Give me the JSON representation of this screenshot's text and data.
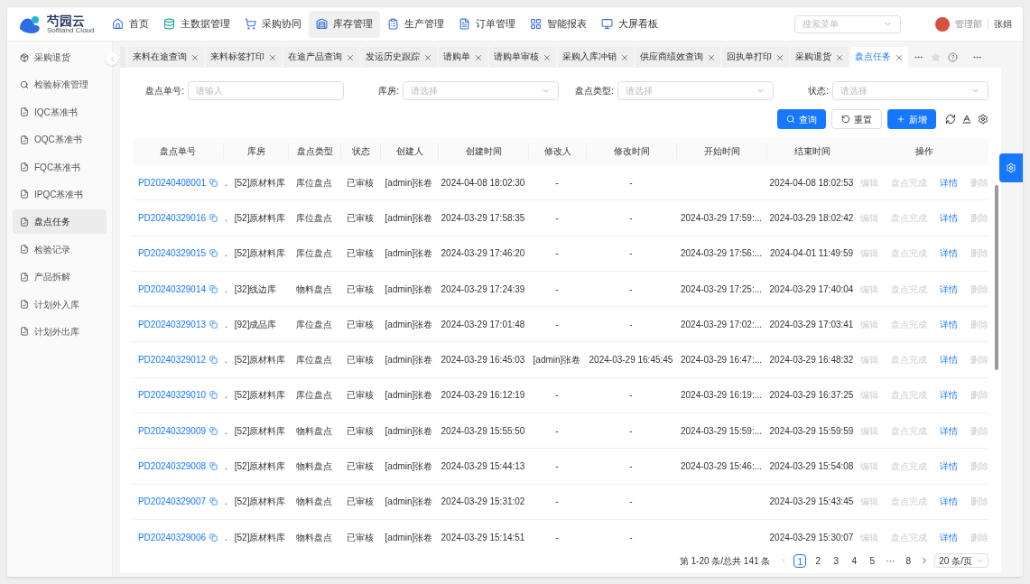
{
  "logo": {
    "name": "芍园云",
    "subtitle": "Softland Cloud"
  },
  "top_nav": [
    {
      "label": "首页",
      "selected": false
    },
    {
      "label": "主数据管理",
      "selected": false
    },
    {
      "label": "采购协同",
      "selected": false
    },
    {
      "label": "库存管理",
      "selected": true
    },
    {
      "label": "生产管理",
      "selected": false
    },
    {
      "label": "订单管理",
      "selected": false
    },
    {
      "label": "智能报表",
      "selected": false
    },
    {
      "label": "大屏看板",
      "selected": false
    }
  ],
  "menu_search": {
    "placeholder": "搜索菜单"
  },
  "user": {
    "department": "管理部",
    "name": "张娟"
  },
  "sidebar": {
    "items": [
      {
        "label": "采购退货",
        "selected": false
      },
      {
        "label": "检验标准管理",
        "selected": false
      },
      {
        "label": "IQC基准书",
        "selected": false
      },
      {
        "label": "OQC基准书",
        "selected": false
      },
      {
        "label": "FQC基准书",
        "selected": false
      },
      {
        "label": "IPQC基准书",
        "selected": false
      },
      {
        "label": "盘点任务",
        "selected": true
      },
      {
        "label": "检验记录",
        "selected": false
      },
      {
        "label": "产品拆解",
        "selected": false
      },
      {
        "label": "计划外入库",
        "selected": false
      },
      {
        "label": "计划外出库",
        "selected": false
      }
    ]
  },
  "tabs": [
    {
      "label": "来料在途查询",
      "selected": false
    },
    {
      "label": "来料标签打印",
      "selected": false
    },
    {
      "label": "在途产品查询",
      "selected": false
    },
    {
      "label": "发运历史跟踪",
      "selected": false
    },
    {
      "label": "请购单",
      "selected": false
    },
    {
      "label": "请购单审核",
      "selected": false
    },
    {
      "label": "采购入库冲销",
      "selected": false
    },
    {
      "label": "供应商绩效查询",
      "selected": false
    },
    {
      "label": "回执单打印",
      "selected": false
    },
    {
      "label": "采购退货",
      "selected": false
    },
    {
      "label": "盘点任务",
      "selected": true
    }
  ],
  "filters": [
    {
      "label": "盘点单号:",
      "placeholder": "请输入",
      "kind": "input"
    },
    {
      "label": "库房:",
      "placeholder": "请选择",
      "kind": "select"
    },
    {
      "label": "盘点类型:",
      "placeholder": "请选择",
      "kind": "select"
    },
    {
      "label": "状态:",
      "placeholder": "请选择",
      "kind": "select"
    }
  ],
  "buttons": [
    {
      "label": "查询",
      "kind": "primary"
    },
    {
      "label": "重置",
      "kind": "default"
    },
    {
      "label": "新增",
      "kind": "primary"
    }
  ],
  "table": {
    "columns": [
      "盘点单号",
      "库房",
      "盘点类型",
      "状态",
      "创建人",
      "创建时间",
      "修改人",
      "修改时间",
      "开始时间",
      "结束时间",
      "操作"
    ],
    "rows": [
      {
        "code": "PD20240408001",
        "mark": ".",
        "warehouse": "[52]原材料库",
        "type": "库位盘点",
        "status": "已审核",
        "creator": "[admin]张卷",
        "created": "2024-04-08 18:02:30",
        "modifier": "-",
        "modified": "-",
        "end": "2024-04-08 18:02:53",
        "actions": [
          {
            "label": "编辑",
            "disabled": true
          },
          {
            "label": "盘点完成",
            "disabled": true
          },
          {
            "label": "详情",
            "disabled": false
          },
          {
            "label": "删除",
            "disabled": true
          }
        ]
      },
      {
        "code": "PD20240329016",
        "mark": ".",
        "warehouse": "[52]原材料库",
        "type": "库位盘点",
        "status": "已审核",
        "creator": "[admin]张卷",
        "created": "2024-03-29 17:58:35",
        "modifier": "-",
        "modified": "-",
        "start": "2024-03-29 17:59:...",
        "end": "2024-03-29 18:02:42",
        "actions": [
          {
            "label": "编辑",
            "disabled": true
          },
          {
            "label": "盘点完成",
            "disabled": true
          },
          {
            "label": "详情",
            "disabled": false
          },
          {
            "label": "删除",
            "disabled": true
          }
        ]
      },
      {
        "code": "PD20240329015",
        "mark": ".",
        "warehouse": "[52]原材料库",
        "type": "库位盘点",
        "status": "已审核",
        "creator": "[admin]张卷",
        "created": "2024-03-29 17:46:20",
        "modifier": "-",
        "modified": "-",
        "start": "2024-03-29 17:56:...",
        "end": "2024-04-01 11:49:59",
        "actions": [
          {
            "label": "编辑",
            "disabled": true
          },
          {
            "label": "盘点完成",
            "disabled": true
          },
          {
            "label": "详情",
            "disabled": false
          },
          {
            "label": "删除",
            "disabled": true
          }
        ]
      },
      {
        "code": "PD20240329014",
        "mark": ".",
        "warehouse": "[32]线边库",
        "type": "物料盘点",
        "status": "已审核",
        "creator": "[admin]张卷",
        "created": "2024-03-29 17:24:39",
        "modifier": "-",
        "modified": "-",
        "start": "2024-03-29 17:25:...",
        "end": "2024-03-29 17:40:04",
        "actions": [
          {
            "label": "编辑",
            "disabled": true
          },
          {
            "label": "盘点完成",
            "disabled": true
          },
          {
            "label": "详情",
            "disabled": false
          },
          {
            "label": "删除",
            "disabled": true
          }
        ]
      },
      {
        "code": "PD20240329013",
        "mark": ".",
        "warehouse": "[92]成品库",
        "type": "库位盘点",
        "status": "已审核",
        "creator": "[admin]张卷",
        "created": "2024-03-29 17:01:48",
        "modifier": "-",
        "modified": "-",
        "start": "2024-03-29 17:02:...",
        "end": "2024-03-29 17:03:41",
        "actions": [
          {
            "label": "编辑",
            "disabled": true
          },
          {
            "label": "盘点完成",
            "disabled": true
          },
          {
            "label": "详情",
            "disabled": false
          },
          {
            "label": "删除",
            "disabled": true
          }
        ]
      },
      {
        "code": "PD20240329012",
        "mark": ".",
        "warehouse": "[52]原材料库",
        "type": "库位盘点",
        "status": "已审核",
        "creator": "[admin]张卷",
        "created": "2024-03-29 16:45:03",
        "modifier": "[admin]张卷",
        "modified": "2024-03-29 16:45:45",
        "start": "2024-03-29 16:47:...",
        "end": "2024-03-29 16:48:32",
        "actions": [
          {
            "label": "编辑",
            "disabled": true
          },
          {
            "label": "盘点完成",
            "disabled": true
          },
          {
            "label": "详情",
            "disabled": false
          },
          {
            "label": "删除",
            "disabled": true
          }
        ]
      },
      {
        "code": "PD20240329010",
        "mark": ".",
        "warehouse": "[52]原材料库",
        "type": "库位盘点",
        "status": "已审核",
        "creator": "[admin]张卷",
        "created": "2024-03-29 16:12:19",
        "modifier": "-",
        "modified": "-",
        "start": "2024-03-29 16:19:...",
        "end": "2024-03-29 16:37:25",
        "actions": [
          {
            "label": "编辑",
            "disabled": true
          },
          {
            "label": "盘点完成",
            "disabled": true
          },
          {
            "label": "详情",
            "disabled": false
          },
          {
            "label": "删除",
            "disabled": true
          }
        ]
      },
      {
        "code": "PD20240329009",
        "mark": ".",
        "warehouse": "[52]原材料库",
        "type": "物料盘点",
        "status": "已审核",
        "creator": "[admin]张卷",
        "created": "2024-03-29 15:55:50",
        "modifier": "-",
        "modified": "-",
        "start": "2024-03-29 15:59:...",
        "end": "2024-03-29 15:59:59",
        "actions": [
          {
            "label": "编辑",
            "disabled": true
          },
          {
            "label": "盘点完成",
            "disabled": true
          },
          {
            "label": "详情",
            "disabled": false
          },
          {
            "label": "删除",
            "disabled": true
          }
        ]
      },
      {
        "code": "PD20240329008",
        "mark": ".",
        "warehouse": "[52]原材料库",
        "type": "物料盘点",
        "status": "已审核",
        "creator": "[admin]张卷",
        "created": "2024-03-29 15:44:13",
        "modifier": "-",
        "modified": "-",
        "start": "2024-03-29 15:46:...",
        "end": "2024-03-29 15:54:08",
        "actions": [
          {
            "label": "编辑",
            "disabled": true
          },
          {
            "label": "盘点完成",
            "disabled": true
          },
          {
            "label": "详情",
            "disabled": false
          },
          {
            "label": "删除",
            "disabled": true
          }
        ]
      },
      {
        "code": "PD20240329007",
        "mark": ".",
        "warehouse": "[52]原材料库",
        "type": "物料盘点",
        "status": "已审核",
        "creator": "[admin]张卷",
        "created": "2024-03-29 15:31:02",
        "modifier": "-",
        "modified": "-",
        "end": "2024-03-29 15:43:45",
        "actions": [
          {
            "label": "编辑",
            "disabled": true
          },
          {
            "label": "盘点完成",
            "disabled": true
          },
          {
            "label": "详情",
            "disabled": false
          },
          {
            "label": "删除",
            "disabled": true
          }
        ]
      },
      {
        "code": "PD20240329006",
        "mark": ".",
        "warehouse": "[52]原材料库",
        "type": "物料盘点",
        "status": "已审核",
        "creator": "[admin]张卷",
        "created": "2024-03-29 15:14:51",
        "modifier": "-",
        "modified": "-",
        "end": "2024-03-29 15:30:07",
        "actions": [
          {
            "label": "编辑",
            "disabled": true
          },
          {
            "label": "盘点完成",
            "disabled": true
          },
          {
            "label": "详情",
            "disabled": false
          },
          {
            "label": "删除",
            "disabled": true
          }
        ]
      }
    ]
  },
  "pagination": {
    "summary": "第 1-20 条/总共 141 条",
    "pages": [
      {
        "label": "1",
        "selected": true
      },
      {
        "label": "2",
        "selected": false
      },
      {
        "label": "3",
        "selected": false
      },
      {
        "label": "4",
        "selected": false
      },
      {
        "label": "5",
        "selected": false
      },
      {
        "label": "···",
        "selected": false
      },
      {
        "label": "8",
        "selected": false
      }
    ],
    "page_size": "20 条/页"
  }
}
